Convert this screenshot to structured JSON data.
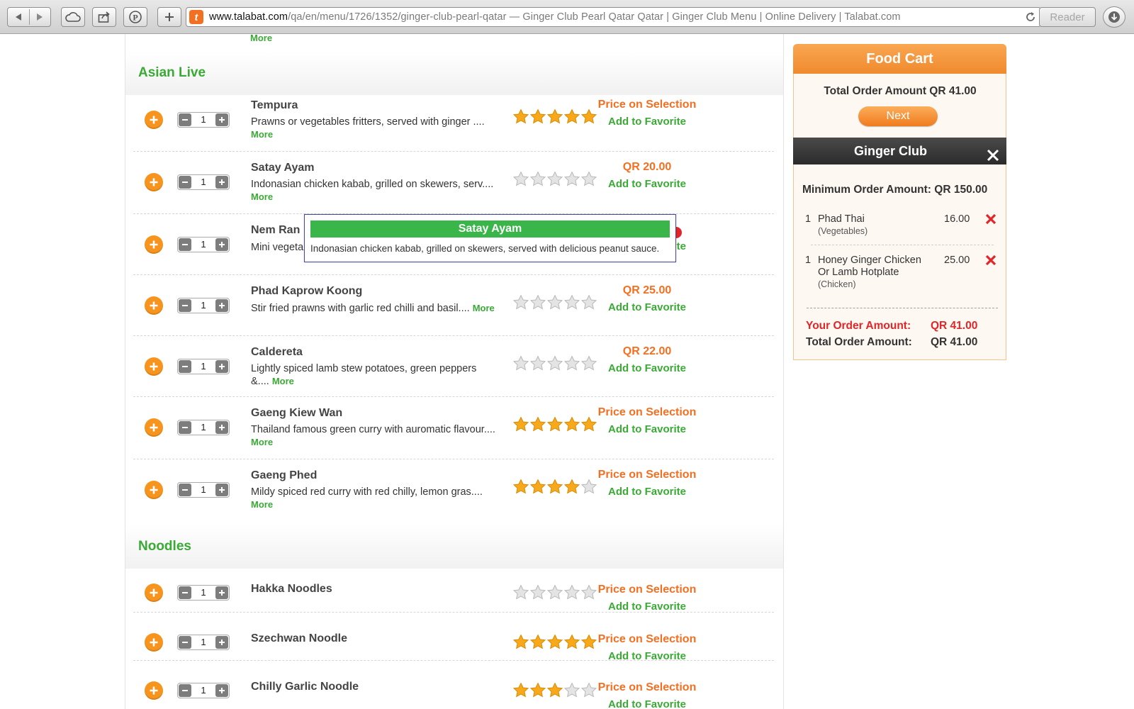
{
  "browser": {
    "address_domain": "www.talabat.com",
    "address_path": "/qa/en/menu/1726/1352/ginger-club-pearl-qatar",
    "page_title": " — Ginger Club Pearl Qatar Qatar | Ginger Club Menu | Online Delivery | Talabat.com",
    "reader_label": "Reader",
    "favicon_letter": "t"
  },
  "top_more": "More",
  "sections": [
    {
      "title": "Asian Live"
    },
    {
      "title": "Noodles"
    }
  ],
  "items": [
    {
      "name": "Tempura",
      "desc": "Prawns or vegetables fritters, served with ginger ....",
      "more": "More",
      "qty": "1",
      "rating": 5,
      "price": "Price on Selection",
      "fav": "Add to Favorite"
    },
    {
      "name": "Satay Ayam",
      "desc": "Indonasian chicken kabab, grilled on skewers, serv....",
      "more": "More",
      "qty": "1",
      "rating": 0,
      "price": "QR 20.00",
      "fav": "Add to Favorite"
    },
    {
      "name": "Nem Ran",
      "desc": "Mini vegeta",
      "more": "More",
      "qty": "1",
      "rating": 0,
      "price": "",
      "fav": "Add to Favorite"
    },
    {
      "name": "Phad Kaprow Koong",
      "desc": "Stir fried prawns with garlic red chilli and basil....",
      "more": "More",
      "qty": "1",
      "rating": 0,
      "price": "QR 25.00",
      "fav": "Add to Favorite"
    },
    {
      "name": "Caldereta",
      "desc": "Lightly spiced lamb stew potatoes, green peppers &....",
      "more": "More",
      "qty": "1",
      "rating": 0,
      "price": "QR 22.00",
      "fav": "Add to Favorite"
    },
    {
      "name": "Gaeng Kiew Wan",
      "desc": "Thailand famous green curry with auromatic flavour....",
      "more": "More",
      "qty": "1",
      "rating": 5,
      "price": "Price on Selection",
      "fav": "Add to Favorite"
    },
    {
      "name": "Gaeng Phed",
      "desc": "Mildy spiced red curry with red chilly, lemon gras....",
      "more": "More",
      "qty": "1",
      "rating": 4,
      "price": "Price on Selection",
      "fav": "Add to Favorite"
    },
    {
      "name": "Hakka Noodles",
      "desc": "",
      "more": "",
      "qty": "1",
      "rating": 0,
      "price": "Price on Selection",
      "fav": "Add to Favorite"
    },
    {
      "name": "Szechwan Noodle",
      "desc": "",
      "more": "",
      "qty": "1",
      "rating": 5,
      "price": "Price on Selection",
      "fav": "Add to Favorite"
    },
    {
      "name": "Chilly Garlic Noodle",
      "desc": "",
      "more": "",
      "qty": "1",
      "rating": 3,
      "price": "Price on Selection",
      "fav": "Add to Favorite"
    }
  ],
  "tooltip": {
    "title": "Satay Ayam",
    "text": "Indonasian chicken kabab, grilled on skewers, served with delicious peanut sauce."
  },
  "cart": {
    "title": "Food Cart",
    "total_line": "Total Order Amount QR 41.00",
    "next_label": "Next",
    "restaurant": "Ginger Club",
    "min_order": "Minimum Order Amount: QR 150.00",
    "items": [
      {
        "qty": "1",
        "name": "Phad Thai",
        "option": "(Vegetables)",
        "price": "16.00"
      },
      {
        "qty": "1",
        "name": "Honey Ginger Chicken Or Lamb Hotplate",
        "option": "(Chicken)",
        "price": "25.00"
      }
    ],
    "your_amount_label": "Your Order Amount:",
    "your_amount_value": "QR 41.00",
    "total_amount_label": "Total Order Amount:",
    "total_amount_value": "QR 41.00"
  },
  "colors": {
    "brand_orange": "#f36f21",
    "brand_green": "#3aa935",
    "star_gold": "#f7a81b",
    "remove_red": "#e0252b"
  }
}
